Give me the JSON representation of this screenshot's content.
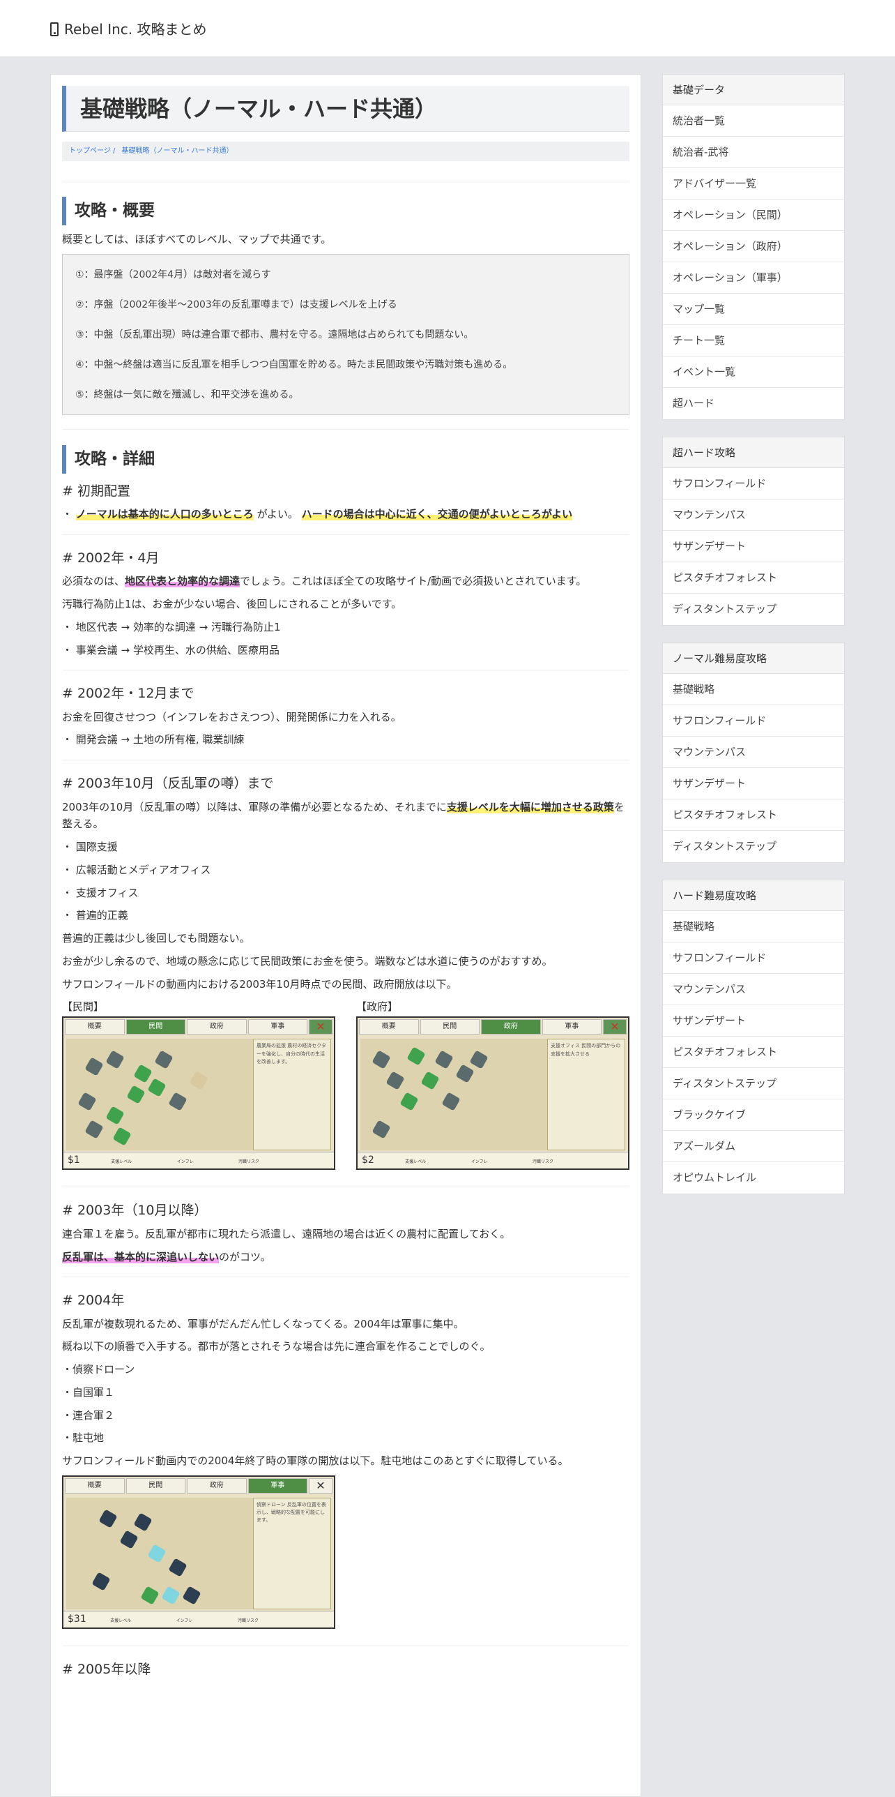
{
  "header": {
    "site_title": "Rebel Inc. 攻略まとめ"
  },
  "page": {
    "title": "基礎戦略（ノーマル・ハード共通）",
    "breadcrumb": [
      "トップページ /",
      "基礎戦略（ノーマル・ハード共通）"
    ]
  },
  "overview": {
    "heading": "攻略・概要",
    "intro": "概要としては、ほぼすべてのレベル、マップで共通です。",
    "steps": [
      "①：最序盤（2002年4月）は敵対者を減らす",
      "②：序盤（2002年後半〜2003年の反乱軍噂まで）は支援レベルを上げる",
      "③：中盤（反乱軍出現）時は連合軍で都市、農村を守る。遠隔地は占められても問題ない。",
      "④：中盤〜終盤は適当に反乱軍を相手しつつ自国軍を貯める。時たま民間政策や汚職対策も進める。",
      "⑤：終盤は一気に敵を殲滅し、和平交渉を進める。"
    ]
  },
  "details": {
    "heading": "攻略・詳細",
    "initial": {
      "title": "# 初期配置",
      "pre": "・",
      "hl1": "ノーマルは基本的に人口の多いところ",
      "mid": "がよい。",
      "hl2": "ハードの場合は中心に近く、交通の便がよいところがよい"
    },
    "apr2002": {
      "title": "# 2002年・4月",
      "p1_pre": "必須なのは、",
      "p1_hl": "地区代表と効率的な調達",
      "p1_post": "でしょう。これはほぼ全ての攻略サイト/動画で必須扱いとされています。",
      "p2": "汚職行為防止1は、お金が少ない場合、後回しにされることが多いです。",
      "b1": "・ 地区代表 → 効率的な調達 → 汚職行為防止1",
      "b2": "・ 事業会議 → 学校再生、水の供給、医療用品"
    },
    "dec2002": {
      "title": "# 2002年・12月まで",
      "p1": "お金を回復させつつ（インフレをおさえつつ）、開発関係に力を入れる。",
      "b1": "・ 開発会議 → 土地の所有権, 職業訓練"
    },
    "oct2003": {
      "title": "# 2003年10月（反乱軍の噂）まで",
      "p1_pre": "2003年の10月（反乱軍の噂）以降は、軍隊の準備が必要となるため、それまでに",
      "p1_hl": "支援レベルを大幅に増加させる政策",
      "p1_post": "を整える。",
      "bullets": [
        "・ 国際支援",
        "・ 広報活動とメディアオフィス",
        "・ 支援オフィス",
        "・ 普遍的正義"
      ],
      "p2": "普遍的正義は少し後回しでも問題ない。",
      "p3": "お金が少し余るので、地域の懸念に応じて民間政策にお金を使う。端数などは水道に使うのがおすすめ。",
      "p4": "サフロンフィールドの動画内における2003年10月時点での民間、政府開放は以下。",
      "shots": [
        {
          "label": "【民間】",
          "tabs": [
            "概要",
            "民間",
            "政府",
            "軍事"
          ],
          "active": 1,
          "money": "$1",
          "panel": "農業局の拡張\n農村の経済セクターを強化し、自分の時代の生活を改善します。",
          "foot": [
            "支援レベル",
            "インフレ",
            "汚職リスク"
          ]
        },
        {
          "label": "【政府】",
          "tabs": [
            "概要",
            "民間",
            "政府",
            "軍事"
          ],
          "active": 2,
          "money": "$2",
          "panel": "支援オフィス\n民間の部門からの支援を拡大させる",
          "foot": [
            "支援レベル",
            "インフレ",
            "汚職リスク"
          ]
        }
      ]
    },
    "after2003": {
      "title": "# 2003年（10月以降）",
      "p1": "連合軍１を雇う。反乱軍が都市に現れたら派遣し、遠隔地の場合は近くの農村に配置しておく。",
      "p2_hl": "反乱軍は、基本的に深追いしない",
      "p2_post": "のがコツ。"
    },
    "y2004": {
      "title": "# 2004年",
      "p1": "反乱軍が複数現れるため、軍事がだんだん忙しくなってくる。2004年は軍事に集中。",
      "p2": "概ね以下の順番で入手する。都市が落とされそうな場合は先に連合軍を作ることでしのぐ。",
      "bullets": [
        "・偵察ドローン",
        "・自国軍１",
        "・連合軍２",
        "・駐屯地"
      ],
      "p3": "サフロンフィールド動画内での2004年終了時の軍隊の開放は以下。駐屯地はこのあとすぐに取得している。",
      "shot": {
        "tabs": [
          "概要",
          "民間",
          "政府",
          "軍事"
        ],
        "active": 3,
        "money": "$31",
        "panel": "偵察ドローン\n反乱軍の位置を表示し、戦略的な配置を可能にします。",
        "foot": [
          "支援レベル",
          "インフレ",
          "汚職リスク"
        ]
      }
    },
    "y2005": {
      "title": "# 2005年以降"
    }
  },
  "sidebar": [
    {
      "title": "基礎データ",
      "items": [
        "統治者一覧",
        "統治者-武将",
        "アドバイザー一覧",
        "オペレーション（民間）",
        "オペレーション（政府）",
        "オペレーション（軍事）",
        "マップ一覧",
        "チート一覧",
        "イベント一覧",
        "超ハード"
      ]
    },
    {
      "title": "超ハード攻略",
      "items": [
        "サフロンフィールド",
        "マウンテンパス",
        "サザンデザート",
        "ピスタチオフォレスト",
        "ディスタントステップ"
      ]
    },
    {
      "title": "ノーマル難易度攻略",
      "items": [
        "基礎戦略",
        "サフロンフィールド",
        "マウンテンパス",
        "サザンデザート",
        "ピスタチオフォレスト",
        "ディスタントステップ"
      ]
    },
    {
      "title": "ハード難易度攻略",
      "items": [
        "基礎戦略",
        "サフロンフィールド",
        "マウンテンパス",
        "サザンデザート",
        "ピスタチオフォレスト",
        "ディスタントステップ",
        "ブラックケイブ",
        "アズールダム",
        "オピウムトレイル"
      ]
    }
  ]
}
